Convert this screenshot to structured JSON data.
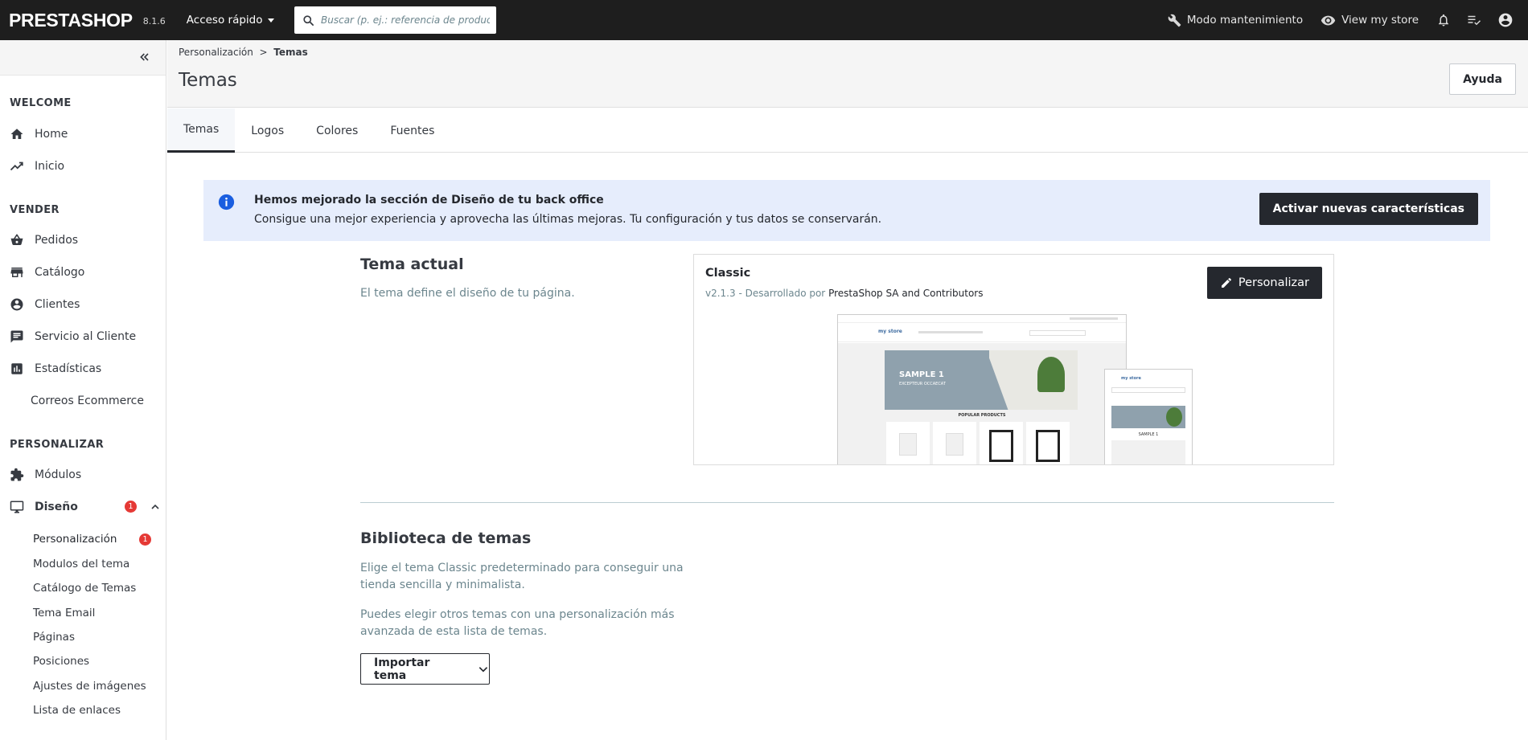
{
  "topbar": {
    "logo": "PRESTASHOP",
    "version": "8.1.6",
    "quick_access": "Acceso rápido",
    "search_placeholder": "Buscar (p. ej.: referencia de producto,",
    "maintenance": "Modo mantenimiento",
    "view_store": "View my store"
  },
  "sidebar": {
    "sections": {
      "welcome": "WELCOME",
      "sell": "VENDER",
      "customize": "PERSONALIZAR"
    },
    "items": {
      "home": "Home",
      "inicio": "Inicio",
      "pedidos": "Pedidos",
      "catalogo": "Catálogo",
      "clientes": "Clientes",
      "servicio": "Servicio al Cliente",
      "estadisticas": "Estadísticas",
      "correos": "Correos Ecommerce",
      "modulos": "Módulos",
      "diseno": "Diseño",
      "diseno_badge": "1"
    },
    "sub_items": {
      "personalizacion": "Personalización",
      "personalizacion_badge": "1",
      "modulos_tema": "Modulos del tema",
      "catalogo_temas": "Catálogo de Temas",
      "tema_email": "Tema Email",
      "paginas": "Páginas",
      "posiciones": "Posiciones",
      "ajustes_imagenes": "Ajustes de imágenes",
      "lista_enlaces": "Lista de enlaces"
    }
  },
  "header": {
    "breadcrumb_parent": "Personalización",
    "breadcrumb_sep": ">",
    "breadcrumb_current": "Temas",
    "title": "Temas",
    "help": "Ayuda"
  },
  "tabs": [
    "Temas",
    "Logos",
    "Colores",
    "Fuentes"
  ],
  "alert": {
    "title": "Hemos mejorado la sección de Diseño de tu back office",
    "text": "Consigue una mejor experiencia y aprovecha las últimas mejoras. Tu configuración y tus datos se conservarán.",
    "button": "Activar nuevas características"
  },
  "current_theme": {
    "heading": "Tema actual",
    "description": "El tema define el diseño de tu página.",
    "name": "Classic",
    "version_prefix": "v2.1.3 - Desarrollado por",
    "author": "PrestaShop SA and Contributors",
    "customize_button": "Personalizar",
    "preview": {
      "slide_title": "SAMPLE 1",
      "slide_sub": "EXCEPTEUR OCCAECAT",
      "popular": "POPULAR PRODUCTS",
      "logo_text": "my store"
    }
  },
  "library": {
    "heading": "Biblioteca de temas",
    "text1_line1": "Elige el tema Classic predeterminado para conseguir una",
    "text1_line2": "tienda sencilla y minimalista.",
    "text2_line1": "Puedes elegir otros temas con una personalización más",
    "text2_line2": "avanzada de esta lista de temas.",
    "import_button": "Importar tema"
  },
  "colors": {
    "topbar": "#1e1e1e",
    "alert_bg": "#e6edfc",
    "badge": "#e53935",
    "info_icon": "#1a5ee0",
    "muted_text": "#6c868e"
  }
}
